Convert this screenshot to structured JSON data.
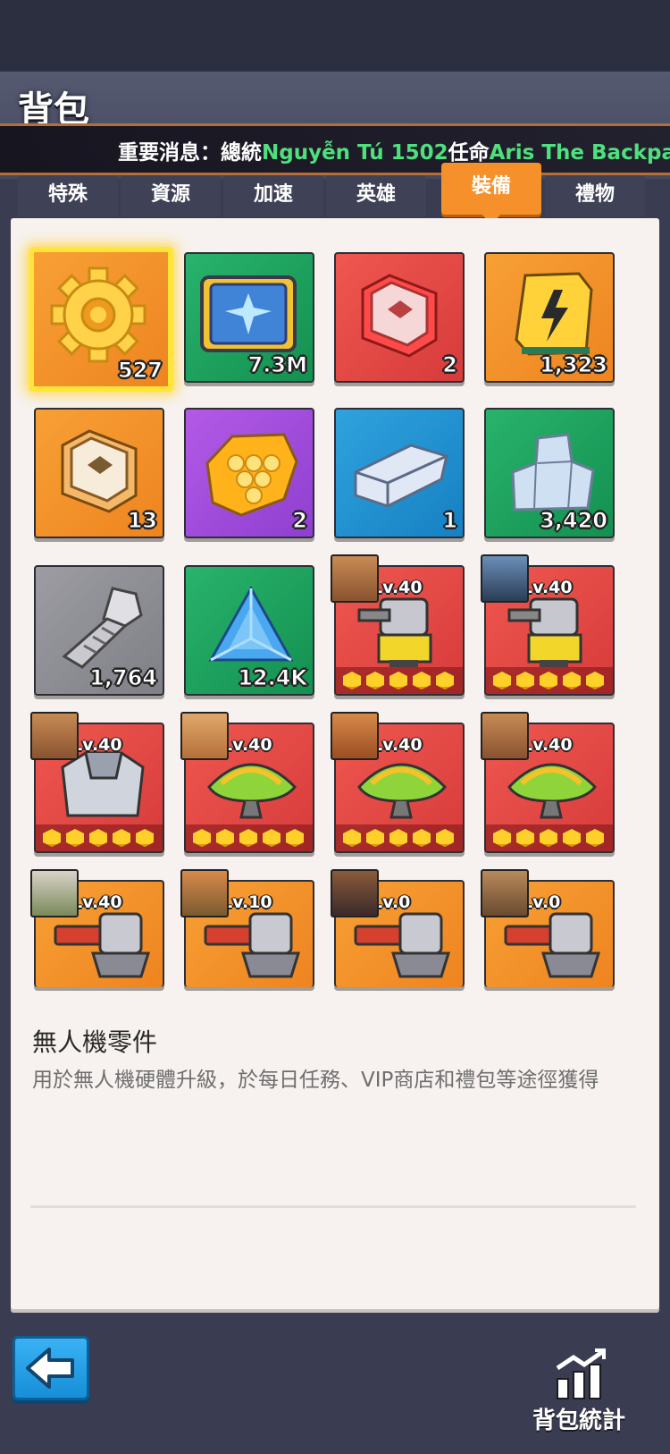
{
  "header": {
    "title": "背包",
    "ticker": {
      "prefix": "重要消息：總統",
      "name1": "Nguyễn Tú 1502",
      "mid": "任命",
      "name2": "Aris The Backpake"
    }
  },
  "tabs": [
    {
      "label": "特殊",
      "active": false
    },
    {
      "label": "資源",
      "active": false
    },
    {
      "label": "加速",
      "active": false
    },
    {
      "label": "英雄",
      "active": false
    },
    {
      "label": "裝備",
      "active": true
    },
    {
      "label": "禮物",
      "active": false
    }
  ],
  "items": [
    {
      "icon": "gear-icon",
      "qty": "527",
      "bg": "orange",
      "selected": true
    },
    {
      "icon": "drone-blueprint-icon",
      "qty": "7.3M",
      "bg": "green"
    },
    {
      "icon": "red-chip-icon",
      "qty": "2",
      "bg": "red"
    },
    {
      "icon": "battery-icon",
      "qty": "1,323",
      "bg": "orange"
    },
    {
      "icon": "orange-chip-icon",
      "qty": "13",
      "bg": "orange"
    },
    {
      "icon": "honeycomb-icon",
      "qty": "2",
      "bg": "purple"
    },
    {
      "icon": "ingot-icon",
      "qty": "1",
      "bg": "blue"
    },
    {
      "icon": "ore-icon",
      "qty": "3,420",
      "bg": "green"
    },
    {
      "icon": "bolt-icon",
      "qty": "1,764",
      "bg": "gray"
    },
    {
      "icon": "crystal-icon",
      "qty": "12.4K",
      "bg": "green"
    }
  ],
  "equipment": [
    {
      "icon": "mech-turret-icon",
      "level": "Lv.40",
      "bg": "red"
    },
    {
      "icon": "mech-turret-icon",
      "level": "Lv.40",
      "bg": "red"
    },
    {
      "icon": "armor-plate-icon",
      "level": "Lv.40",
      "bg": "red"
    },
    {
      "icon": "radar-dish-icon",
      "level": "Lv.40",
      "bg": "red"
    },
    {
      "icon": "radar-dish-icon",
      "level": "Lv.40",
      "bg": "red"
    },
    {
      "icon": "radar-dish-icon",
      "level": "Lv.40",
      "bg": "red"
    },
    {
      "icon": "cannon-icon",
      "level": "Lv.40",
      "bg": "orange"
    },
    {
      "icon": "cannon-icon",
      "level": "Lv.10",
      "bg": "orange"
    },
    {
      "icon": "cannon-icon",
      "level": "Lv.0",
      "bg": "orange"
    },
    {
      "icon": "cannon-icon",
      "level": "Lv.0",
      "bg": "orange"
    }
  ],
  "detail": {
    "title": "無人機零件",
    "text": "用於無人機硬體升級，於每日任務、VIP商店和禮包等途徑獲得"
  },
  "footer": {
    "back_icon": "arrow-left-icon",
    "stats_label": "背包統計"
  },
  "colors": {
    "accent": "#f5902a",
    "highlight": "#ffe53a",
    "ticker_name": "#4fe07e"
  }
}
